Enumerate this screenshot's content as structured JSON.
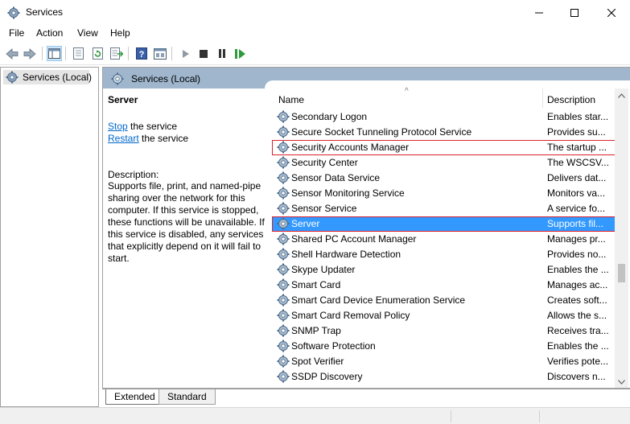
{
  "window": {
    "title": "Services",
    "controls": {
      "minimize": "minimize",
      "maximize": "maximize",
      "close": "close"
    }
  },
  "menu": [
    "File",
    "Action",
    "View",
    "Help"
  ],
  "tree": {
    "root_label": "Services (Local)"
  },
  "content_header": {
    "title": "Services (Local)"
  },
  "details": {
    "service_name": "Server",
    "stop_link": "Stop",
    "stop_suffix": " the service",
    "restart_link": "Restart",
    "restart_suffix": " the service",
    "description_label": "Description:",
    "description_text": "Supports file, print, and named-pipe sharing over the network for this computer. If this service is stopped, these functions will be unavailable. If this service is disabled, any services that explicitly depend on it will fail to start."
  },
  "list": {
    "columns": [
      "Name",
      "Description"
    ],
    "sort_indicator": "^",
    "rows": [
      {
        "name": "Secondary Logon",
        "description": "Enables star...",
        "selected": false,
        "highlighted": false
      },
      {
        "name": "Secure Socket Tunneling Protocol Service",
        "description": "Provides su...",
        "selected": false,
        "highlighted": false
      },
      {
        "name": "Security Accounts Manager",
        "description": "The startup ...",
        "selected": false,
        "highlighted": true
      },
      {
        "name": "Security Center",
        "description": "The WSCSV...",
        "selected": false,
        "highlighted": false
      },
      {
        "name": "Sensor Data Service",
        "description": "Delivers dat...",
        "selected": false,
        "highlighted": false
      },
      {
        "name": "Sensor Monitoring Service",
        "description": "Monitors va...",
        "selected": false,
        "highlighted": false
      },
      {
        "name": "Sensor Service",
        "description": "A service fo...",
        "selected": false,
        "highlighted": false
      },
      {
        "name": "Server",
        "description": "Supports fil...",
        "selected": true,
        "highlighted": true
      },
      {
        "name": "Shared PC Account Manager",
        "description": "Manages pr...",
        "selected": false,
        "highlighted": false
      },
      {
        "name": "Shell Hardware Detection",
        "description": "Provides no...",
        "selected": false,
        "highlighted": false
      },
      {
        "name": "Skype Updater",
        "description": "Enables the ...",
        "selected": false,
        "highlighted": false
      },
      {
        "name": "Smart Card",
        "description": "Manages ac...",
        "selected": false,
        "highlighted": false
      },
      {
        "name": "Smart Card Device Enumeration Service",
        "description": "Creates soft...",
        "selected": false,
        "highlighted": false
      },
      {
        "name": "Smart Card Removal Policy",
        "description": "Allows the s...",
        "selected": false,
        "highlighted": false
      },
      {
        "name": "SNMP Trap",
        "description": "Receives tra...",
        "selected": false,
        "highlighted": false
      },
      {
        "name": "Software Protection",
        "description": "Enables the ...",
        "selected": false,
        "highlighted": false
      },
      {
        "name": "Spot Verifier",
        "description": "Verifies pote...",
        "selected": false,
        "highlighted": false
      },
      {
        "name": "SSDP Discovery",
        "description": "Discovers n...",
        "selected": false,
        "highlighted": false
      }
    ]
  },
  "tabs": [
    "Extended",
    "Standard"
  ],
  "toolbar_icons": [
    "back-icon",
    "forward-icon",
    "show-hide-tree-icon",
    "properties-icon",
    "refresh-icon",
    "export-list-icon",
    "help-icon",
    "mmc-console-icon",
    "start-service-icon",
    "stop-service-icon",
    "pause-service-icon",
    "restart-service-icon"
  ],
  "colors": {
    "selection": "#3399ff",
    "highlight_outline": "#d9232e",
    "header_band": "#9fb6cd",
    "link": "#0066cc"
  }
}
